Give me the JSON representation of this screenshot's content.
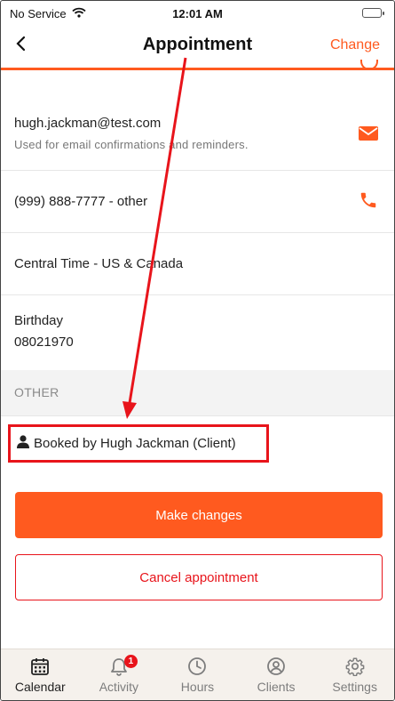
{
  "status_bar": {
    "carrier": "No Service",
    "time": "12:01 AM"
  },
  "header": {
    "title": "Appointment",
    "action_label": "Change"
  },
  "contact": {
    "email": "hugh.jackman@test.com",
    "email_note": "Used for email confirmations and reminders.",
    "phone": "(999) 888-7777 - other",
    "timezone": "Central Time - US & Canada",
    "birthday_label": "Birthday",
    "birthday_value": "08021970"
  },
  "other_section": {
    "title": "OTHER",
    "booked_by": "Booked by Hugh Jackman (Client)"
  },
  "actions": {
    "primary_label": "Make changes",
    "secondary_label": "Cancel appointment"
  },
  "tab_bar": {
    "tabs": [
      {
        "label": "Calendar",
        "icon": "calendar-icon",
        "active": true
      },
      {
        "label": "Activity",
        "icon": "bell-icon",
        "badge": "1"
      },
      {
        "label": "Hours",
        "icon": "clock-icon"
      },
      {
        "label": "Clients",
        "icon": "user-circle-icon"
      },
      {
        "label": "Settings",
        "icon": "gear-icon"
      }
    ]
  },
  "colors": {
    "accent": "#ff5a1f",
    "danger": "#e8141b",
    "tab_bar_bg": "#f5f1ec"
  }
}
